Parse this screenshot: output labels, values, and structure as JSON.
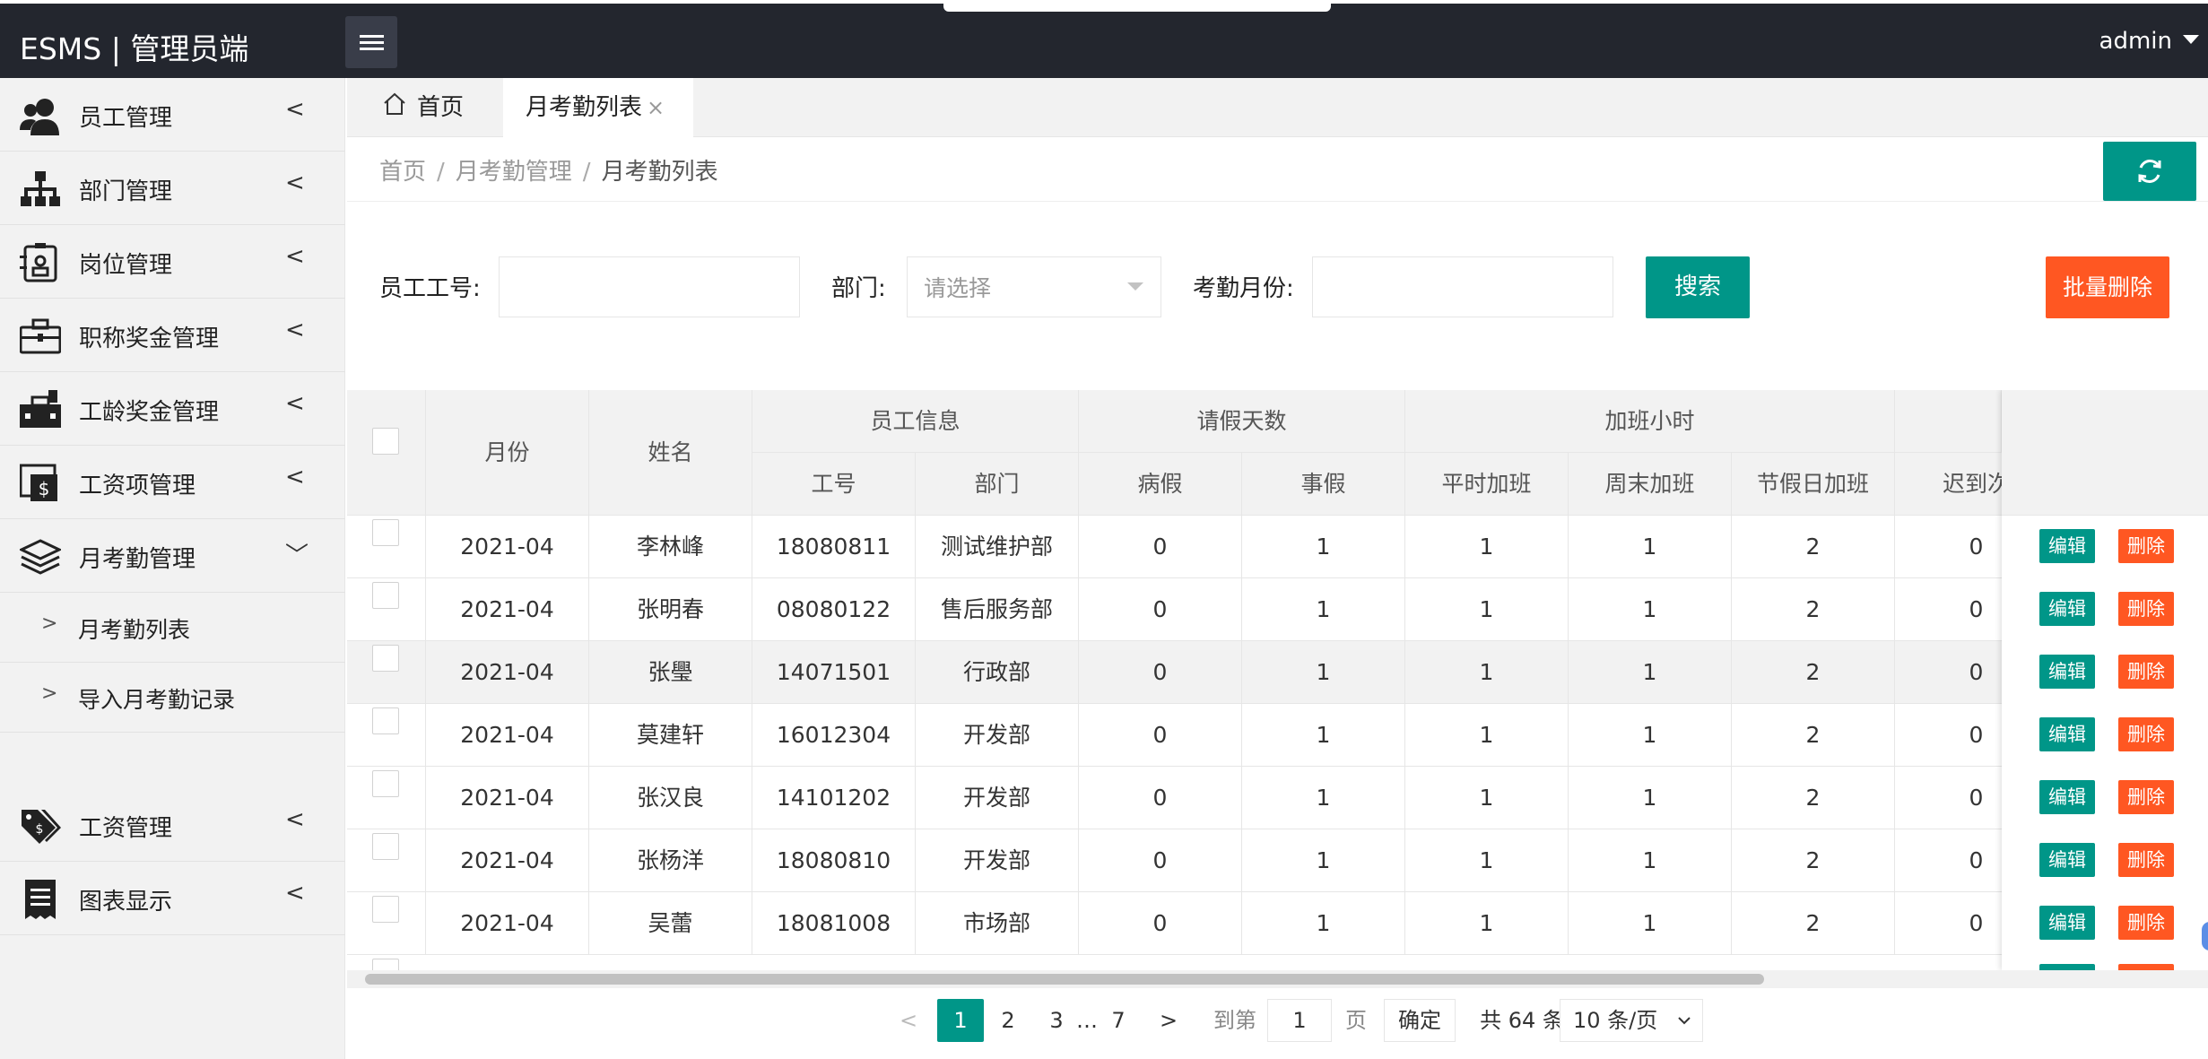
{
  "app": {
    "title": "ESMS | 管理员端",
    "user": "admin"
  },
  "sidebar": {
    "items": [
      {
        "label": "员工管理",
        "icon": "users-icon"
      },
      {
        "label": "部门管理",
        "icon": "sitemap-icon"
      },
      {
        "label": "岗位管理",
        "icon": "id-badge-icon"
      },
      {
        "label": "职称奖金管理",
        "icon": "briefcase-icon"
      },
      {
        "label": "工龄奖金管理",
        "icon": "toolbox-icon"
      },
      {
        "label": "工资项管理",
        "icon": "salary-item-icon"
      },
      {
        "label": "月考勤管理",
        "icon": "layers-icon"
      },
      {
        "label": "工资管理",
        "icon": "tags-icon"
      },
      {
        "label": "图表显示",
        "icon": "receipt-icon"
      }
    ],
    "sub_items": [
      {
        "label": "月考勤列表"
      },
      {
        "label": "导入月考勤记录"
      }
    ],
    "collapsed_arrow": "<",
    "expanded_arrow": "﹀",
    "sub_chevron": ">"
  },
  "tabs": {
    "home": "首页",
    "active": "月考勤列表",
    "close": "×"
  },
  "breadcrumb": {
    "home": "首页",
    "level2": "月考勤管理",
    "current": "月考勤列表",
    "sep": "/"
  },
  "filter": {
    "emp_no_label": "员工工号:",
    "dept_label": "部门:",
    "dept_placeholder": "请选择",
    "month_label": "考勤月份:",
    "search_button": "搜索",
    "bulk_delete_button": "批量删除"
  },
  "table": {
    "headers": {
      "month": "月份",
      "name": "姓名",
      "emp_info": "员工信息",
      "leave_days": "请假天数",
      "overtime_hours": "加班小时",
      "emp_no": "工号",
      "dept": "部门",
      "sick_leave": "病假",
      "personal_leave": "事假",
      "weekday_ot": "平时加班",
      "weekend_ot": "周末加班",
      "holiday_ot": "节假日加班",
      "late": "迟到次"
    },
    "rows": [
      {
        "month": "2021-04",
        "name": "李林峰",
        "emp_no": "18080811",
        "dept": "测试维护部",
        "sick": "0",
        "personal": "1",
        "weekday": "1",
        "weekend": "1",
        "holiday": "2",
        "late": "0"
      },
      {
        "month": "2021-04",
        "name": "张明春",
        "emp_no": "08080122",
        "dept": "售后服务部",
        "sick": "0",
        "personal": "1",
        "weekday": "1",
        "weekend": "1",
        "holiday": "2",
        "late": "0"
      },
      {
        "month": "2021-04",
        "name": "张璺",
        "emp_no": "14071501",
        "dept": "行政部",
        "sick": "0",
        "personal": "1",
        "weekday": "1",
        "weekend": "1",
        "holiday": "2",
        "late": "0"
      },
      {
        "month": "2021-04",
        "name": "莫建轩",
        "emp_no": "16012304",
        "dept": "开发部",
        "sick": "0",
        "personal": "1",
        "weekday": "1",
        "weekend": "1",
        "holiday": "2",
        "late": "0"
      },
      {
        "month": "2021-04",
        "name": "张汉良",
        "emp_no": "14101202",
        "dept": "开发部",
        "sick": "0",
        "personal": "1",
        "weekday": "1",
        "weekend": "1",
        "holiday": "2",
        "late": "0"
      },
      {
        "month": "2021-04",
        "name": "张杨洋",
        "emp_no": "18080810",
        "dept": "开发部",
        "sick": "0",
        "personal": "1",
        "weekday": "1",
        "weekend": "1",
        "holiday": "2",
        "late": "0"
      },
      {
        "month": "2021-04",
        "name": "吴蕾",
        "emp_no": "18081008",
        "dept": "市场部",
        "sick": "0",
        "personal": "1",
        "weekday": "1",
        "weekend": "1",
        "holiday": "2",
        "late": "0"
      }
    ],
    "edit_label": "编辑",
    "delete_label": "删除"
  },
  "pagination": {
    "prev": "<",
    "pages": [
      "1",
      "2",
      "3"
    ],
    "ellipsis": "…",
    "last_page": "7",
    "next": ">",
    "goto_label": "到第",
    "goto_value": "1",
    "page_unit": "页",
    "confirm": "确定",
    "total": "共 64 条",
    "page_size": "10 条/页"
  },
  "colors": {
    "header_bg": "#23262e",
    "primary": "#009688",
    "danger": "#ff5722",
    "sidebar_bg": "#f2f2f2"
  }
}
